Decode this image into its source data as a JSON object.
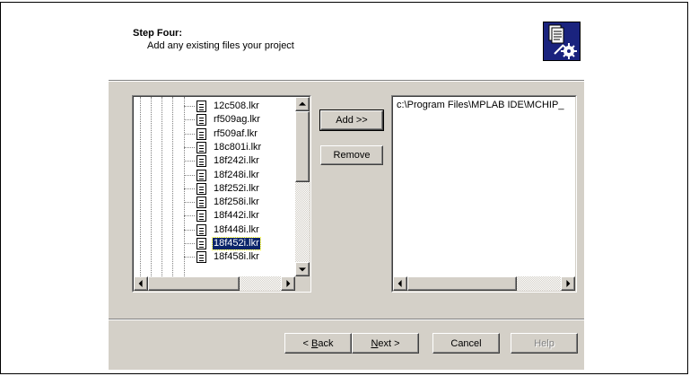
{
  "header": {
    "step_title": "Step Four:",
    "step_description": "Add any existing files your project",
    "icon": "wizard-settings-icon"
  },
  "file_tree": {
    "items": [
      {
        "label": "12c508.lkr",
        "selected": false
      },
      {
        "label": "rf509ag.lkr",
        "selected": false
      },
      {
        "label": "rf509af.lkr",
        "selected": false
      },
      {
        "label": "18c801i.lkr",
        "selected": false
      },
      {
        "label": "18f242i.lkr",
        "selected": false
      },
      {
        "label": "18f248i.lkr",
        "selected": false
      },
      {
        "label": "18f252i.lkr",
        "selected": false
      },
      {
        "label": "18f258i.lkr",
        "selected": false
      },
      {
        "label": "18f442i.lkr",
        "selected": false
      },
      {
        "label": "18f448i.lkr",
        "selected": false
      },
      {
        "label": "18f452i.lkr",
        "selected": true
      },
      {
        "label": "18f458i.lkr",
        "selected": false
      }
    ]
  },
  "actions": {
    "add_label": "Add >>",
    "remove_label": "Remove"
  },
  "project_files": {
    "items": [
      "c:\\Program Files\\MPLAB IDE\\MCHIP_"
    ]
  },
  "footer": {
    "back": {
      "prefix": "< ",
      "mnemonic": "B",
      "rest": "ack"
    },
    "next": {
      "mnemonic": "N",
      "rest": "ext >"
    },
    "cancel_label": "Cancel",
    "help_label": "Help"
  }
}
